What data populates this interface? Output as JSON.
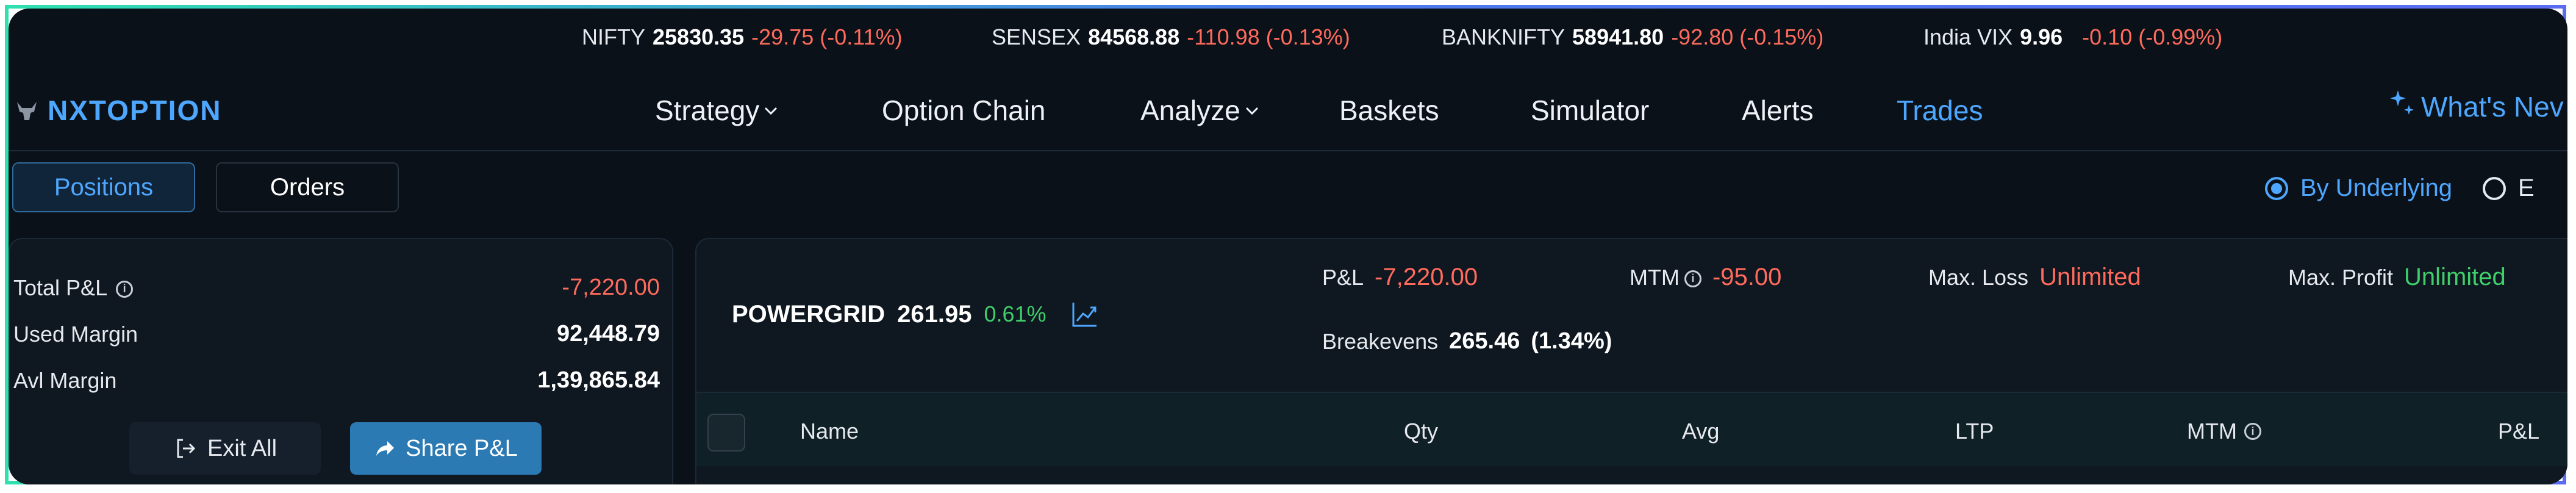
{
  "ticker": [
    {
      "name": "NIFTY",
      "value": "25830.35",
      "change": "-29.75 (-0.11%)"
    },
    {
      "name": "SENSEX",
      "value": "84568.88",
      "change": "-110.98 (-0.13%)"
    },
    {
      "name": "BANKNIFTY",
      "value": "58941.80",
      "change": "-92.80 (-0.15%)"
    },
    {
      "name": "India VIX",
      "value": "9.96",
      "change": "-0.10 (-0.99%)"
    }
  ],
  "brand": {
    "name": "NXTOPTION"
  },
  "nav": {
    "items": [
      {
        "label": "Strategy",
        "has_dropdown": true
      },
      {
        "label": "Option Chain"
      },
      {
        "label": "Analyze",
        "has_dropdown": true
      },
      {
        "label": "Baskets"
      },
      {
        "label": "Simulator"
      },
      {
        "label": "Alerts"
      },
      {
        "label": "Trades",
        "active": true
      }
    ],
    "whats_new": "What's Nev"
  },
  "tabs": [
    {
      "label": "Positions",
      "active": true
    },
    {
      "label": "Orders"
    }
  ],
  "view_toggle": {
    "selected": "By Underlying",
    "other_partial": "E"
  },
  "summary": {
    "total_pnl_label": "Total P&L",
    "total_pnl": "-7,220.00",
    "used_margin_label": "Used Margin",
    "used_margin": "92,448.79",
    "avl_margin_label": "Avl Margin",
    "avl_margin": "1,39,865.84",
    "exit_all": "Exit All",
    "share_pnl": "Share P&L"
  },
  "position": {
    "symbol": "POWERGRID",
    "ltp": "261.95",
    "change_pct": "0.61%",
    "pnl_label": "P&L",
    "pnl": "-7,220.00",
    "mtm_label": "MTM",
    "mtm": "-95.00",
    "max_loss_label": "Max. Loss",
    "max_loss": "Unlimited",
    "max_profit_label": "Max. Profit",
    "max_profit": "Unlimited",
    "breakevens_label": "Breakevens",
    "breakevens": "265.46",
    "breakevens_pct": "(1.34%)"
  },
  "table": {
    "columns": [
      "Name",
      "Qty",
      "Avg",
      "LTP",
      "MTM",
      "P&L"
    ]
  },
  "colors": {
    "accent": "#4ea7ff",
    "negative": "#ff6b5c",
    "positive": "#3fcf6b",
    "background": "#0b1119",
    "share_button": "#2b7ab3"
  }
}
